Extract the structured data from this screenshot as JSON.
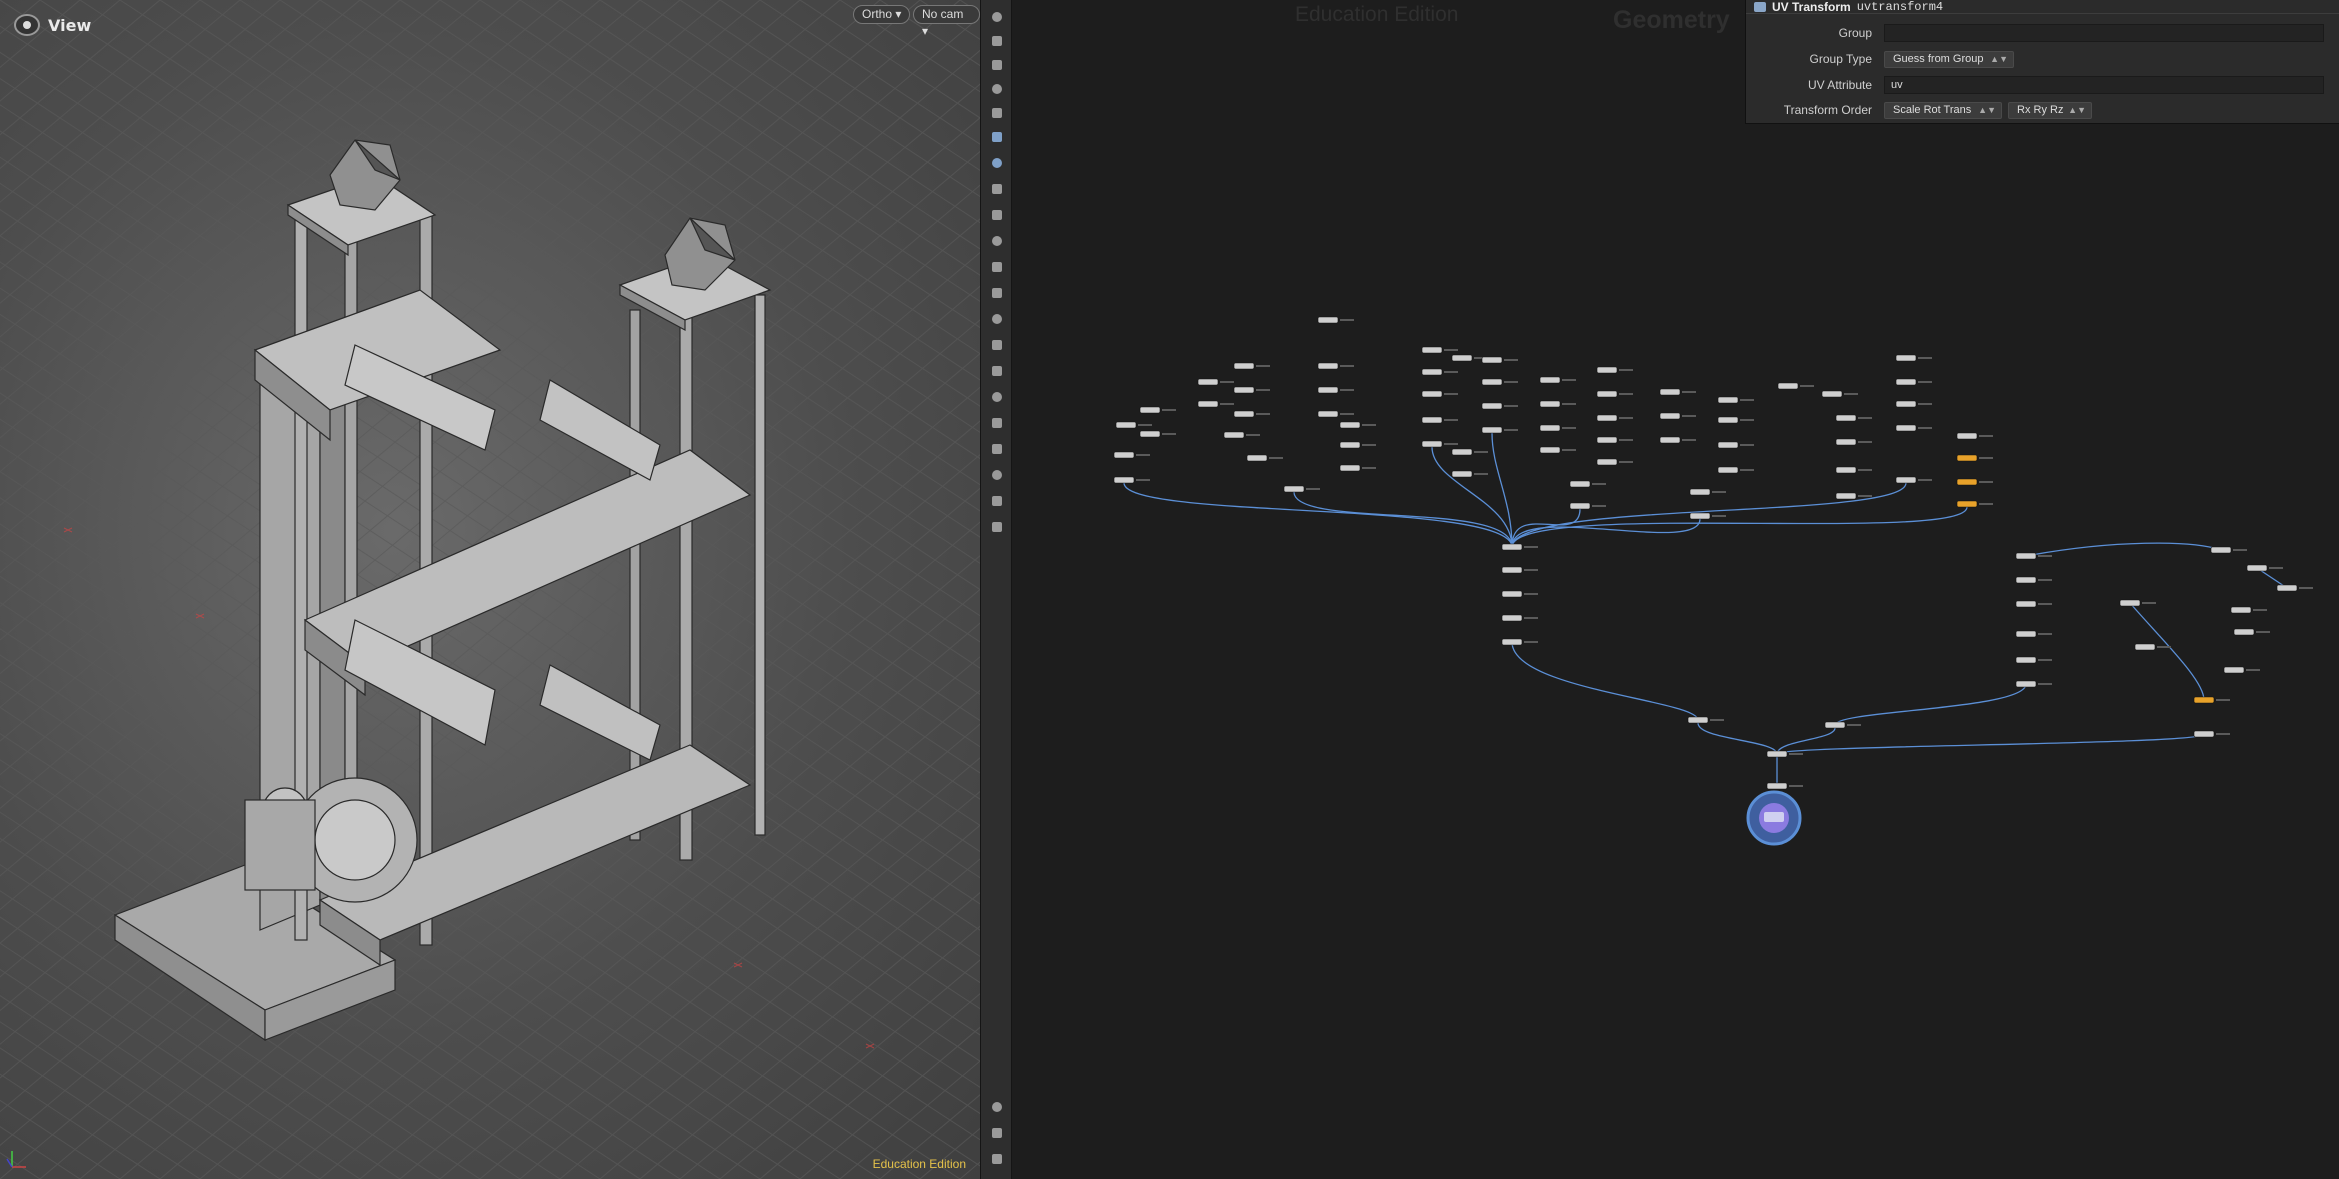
{
  "viewport": {
    "title": "View",
    "camera_mode": "Ortho",
    "camera": "No cam",
    "edition_label": "Education Edition",
    "eye_icon": "viewport-eye-icon"
  },
  "network": {
    "watermark_edition": "Education Edition",
    "watermark_context": "Geometry"
  },
  "params": {
    "node_type": "UV Transform",
    "node_name": "uvtransform4",
    "fields": {
      "group_label": "Group",
      "group_value": "",
      "group_type_label": "Group Type",
      "group_type_value": "Guess from Group",
      "uv_attribute_label": "UV Attribute",
      "uv_attribute_value": "uv",
      "transform_order_label": "Transform Order",
      "transform_order_value": "Scale Rot Trans",
      "rotation_order_value": "Rx Ry Rz"
    }
  },
  "colors": {
    "accent_wire": "#5b8fd6",
    "node_bypass": "#e8a22a",
    "edu_yellow": "#e5c24a",
    "display_node": "#6f5fd0"
  },
  "toolbar_icons": [
    "select-icon",
    "lock-icon",
    "light-icon",
    "sphere-icon",
    "camera-icon",
    "transform-icon",
    "snap-icon",
    "handle-icon",
    "point-icon",
    "brush-icon",
    "pin-icon",
    "measure-icon",
    "paint-icon",
    "sculpt-icon",
    "knife-icon",
    "wire-icon",
    "grid-icon",
    "shade-icon",
    "texture-icon",
    "solid-icon",
    "display-icon",
    "info-icon",
    "layout-icon",
    "render-icon"
  ]
}
